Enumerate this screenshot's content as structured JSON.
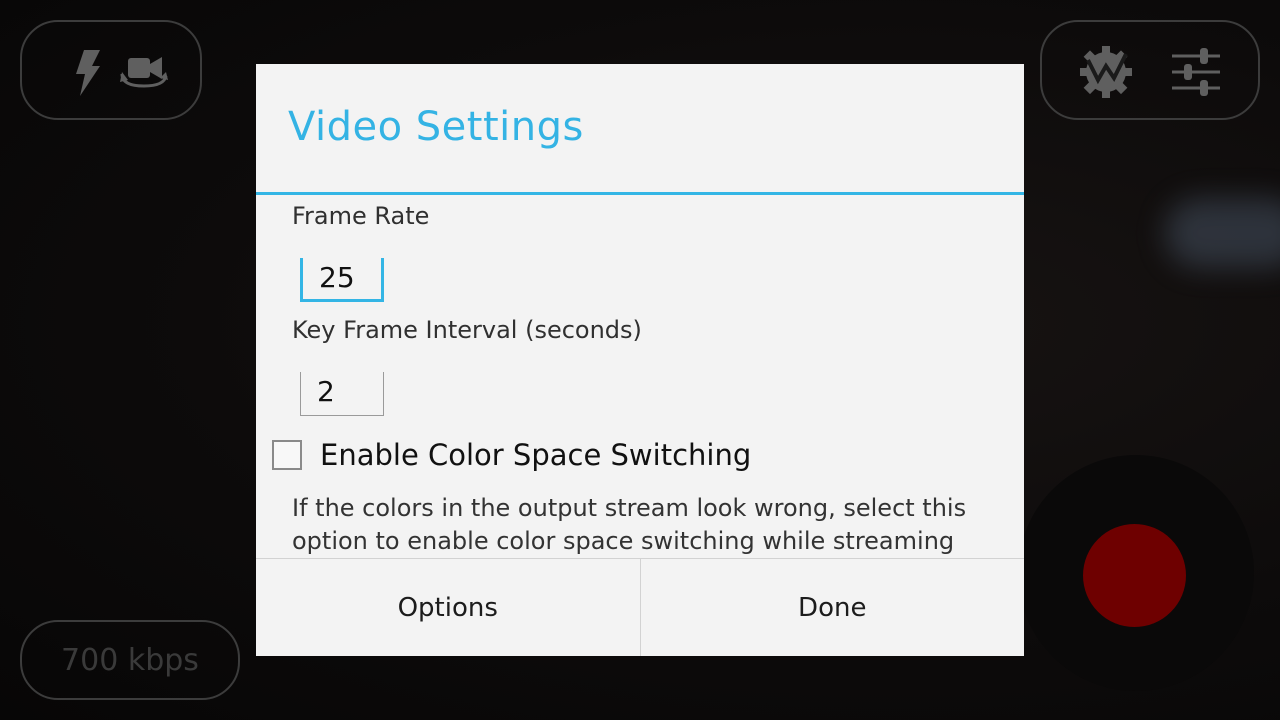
{
  "camera": {
    "bitrate": "700 kbps",
    "icons": [
      "flash-icon",
      "switch-camera-icon",
      "broadcast-settings-icon",
      "sliders-icon",
      "record-icon"
    ],
    "record_color": "#6e0000"
  },
  "dialog": {
    "title": "Video Settings",
    "accent": "#33b5e5",
    "frame_rate": {
      "label": "Frame Rate",
      "value": "25"
    },
    "key_frame": {
      "label": "Key Frame Interval (seconds)",
      "value": "2"
    },
    "color_space": {
      "label": "Enable Color Space Switching",
      "checked": false,
      "help": "If the colors in the output stream look wrong, select this option to enable color space switching while streaming"
    },
    "buttons": {
      "options": "Options",
      "done": "Done"
    }
  }
}
